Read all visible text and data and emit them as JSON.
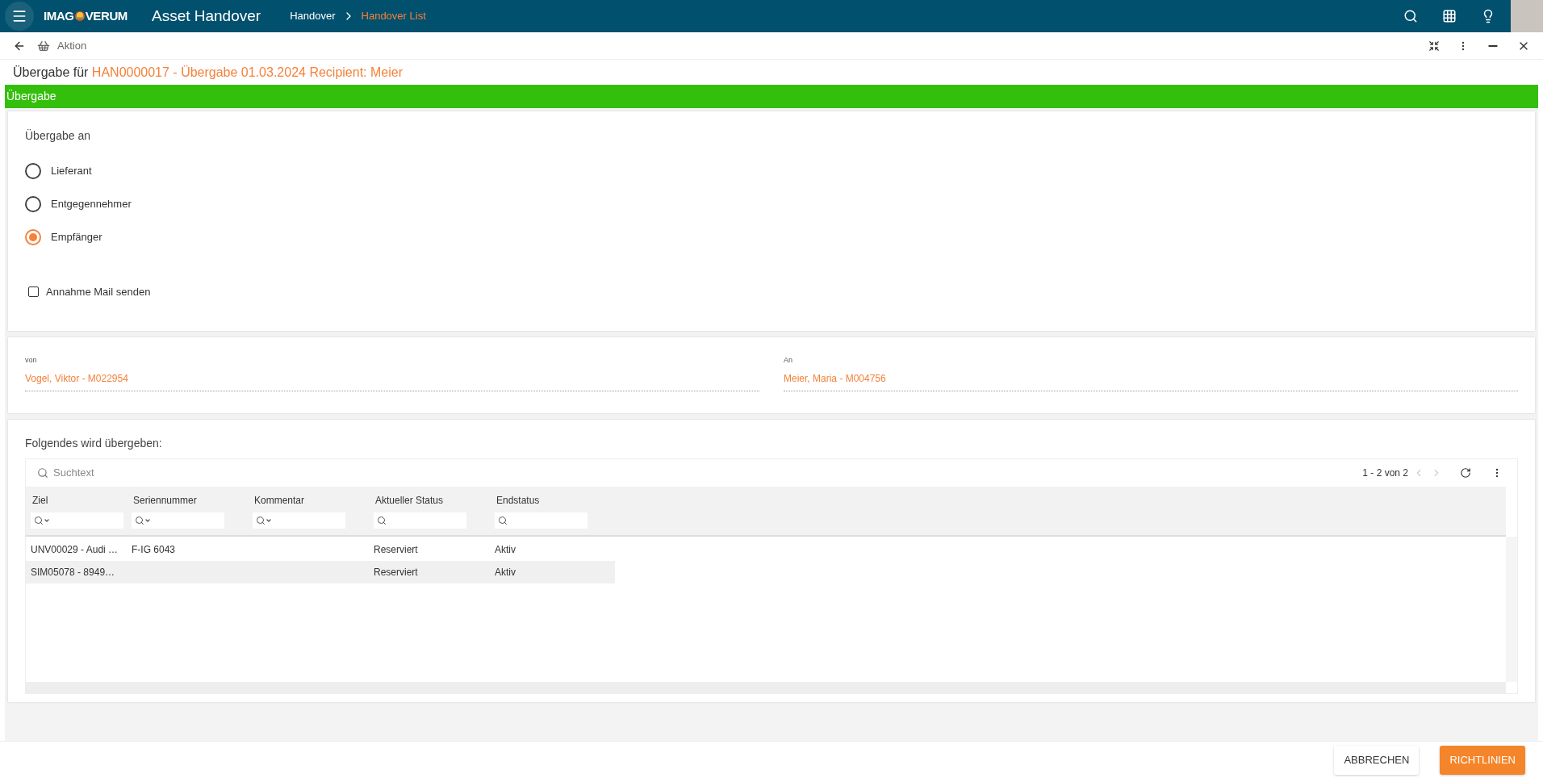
{
  "app_bar": {
    "logo_left": "IMAG",
    "logo_right": "VERUM",
    "title": "Asset Handover",
    "breadcrumbs": [
      {
        "label": "Handover",
        "current": false
      },
      {
        "label": "Handover List",
        "current": true
      }
    ]
  },
  "toolbar": {
    "label": "Aktion"
  },
  "heading": {
    "prefix": "Übergabe für",
    "record": "HAN0000017 - Übergabe 01.03.2024 Recipient: Meier"
  },
  "section_bar": {
    "label": "Übergabe"
  },
  "handover_to": {
    "label": "Übergabe an",
    "options": [
      {
        "label": "Lieferant",
        "selected": false
      },
      {
        "label": "Entgegennehmer",
        "selected": false
      },
      {
        "label": "Empfänger",
        "selected": true
      }
    ],
    "mail": {
      "label": "Annahme Mail senden",
      "checked": false
    }
  },
  "parties": [
    {
      "label": "von",
      "value": "Vogel, Viktor - M022954"
    },
    {
      "label": "An",
      "value": "Meier, Maria - M004756"
    }
  ],
  "items": {
    "label": "Folgendes wird übergeben:",
    "search": {
      "placeholder": "Suchtext"
    },
    "pagination": "1 - 2 von 2",
    "columns": [
      {
        "label": "Ziel",
        "kind": "menu"
      },
      {
        "label": "Seriennummer",
        "kind": "menu"
      },
      {
        "label": "Kommentar",
        "kind": "menu"
      },
      {
        "label": "Aktueller Status",
        "kind": "plain"
      },
      {
        "label": "Endstatus",
        "kind": "plain"
      }
    ],
    "rows": [
      {
        "cells": [
          "UNV00029 - Audi …",
          "F-IG 6043",
          "",
          "Reserviert",
          "Aktiv"
        ],
        "selected": false
      },
      {
        "cells": [
          "SIM05078 - 8949…",
          "",
          "",
          "Reserviert",
          "Aktiv"
        ],
        "selected": true
      }
    ]
  },
  "buttons": [
    {
      "label": "ABBRECHEN",
      "kind": "secondary"
    },
    {
      "label": "RICHTLINIEN",
      "kind": "primary"
    }
  ]
}
